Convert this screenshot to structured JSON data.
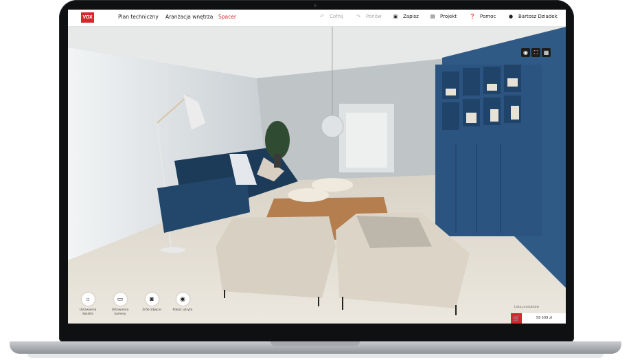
{
  "app": {
    "logo_text": "VOX",
    "brand_color": "#d7262e"
  },
  "nav": {
    "tabs": [
      {
        "label": "Plan techniczny",
        "active": false
      },
      {
        "label": "Aranżacja wnętrza",
        "active": false
      },
      {
        "label": "Spacer",
        "active": true
      }
    ]
  },
  "toolbar": {
    "undo_label": "Cofnij",
    "redo_label": "Ponów",
    "save_label": "Zapisz",
    "project_label": "Projekt",
    "help_label": "Pomoc",
    "user_name": "Bartosz Dziadek"
  },
  "view_controls": [
    {
      "icon": "target-icon"
    },
    {
      "icon": "fullscreen-icon"
    },
    {
      "icon": "grid-icon"
    }
  ],
  "actions": [
    {
      "label": "Ustawienia światła",
      "icon": "light-icon"
    },
    {
      "label": "Ustawienia kamery",
      "icon": "camera-settings-icon"
    },
    {
      "label": "Zrób zdjęcie",
      "icon": "photo-icon"
    },
    {
      "label": "Pokaż ukryte",
      "icon": "eye-icon"
    }
  ],
  "products": {
    "label": "Lista produktów",
    "price": "59 509 zł",
    "icon": "cart-icon"
  }
}
